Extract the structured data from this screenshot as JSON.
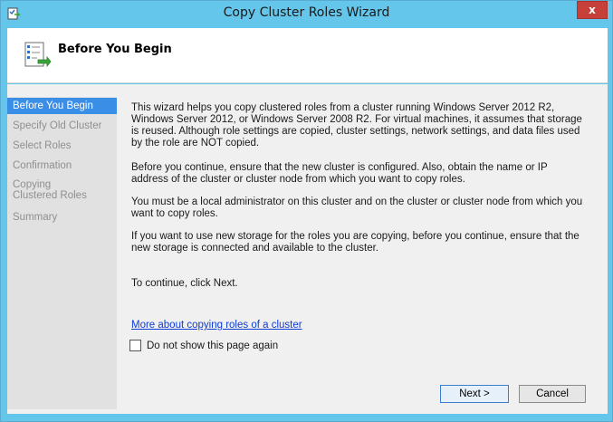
{
  "window": {
    "title": "Copy Cluster Roles Wizard",
    "close_label": "x"
  },
  "header": {
    "title": "Before You Begin"
  },
  "nav": {
    "items": [
      {
        "label": "Before You Begin",
        "active": true
      },
      {
        "label": "Specify Old Cluster",
        "active": false
      },
      {
        "label": "Select Roles",
        "active": false
      },
      {
        "label": "Confirmation",
        "active": false
      },
      {
        "label": "Copying Clustered Roles",
        "active": false
      },
      {
        "label": "Summary",
        "active": false
      }
    ]
  },
  "content": {
    "paragraphs": [
      "This wizard helps you copy clustered roles from a cluster running Windows Server 2012 R2, Windows Server 2012, or Windows Server 2008 R2. For virtual machines, it assumes that storage is reused. Although role settings are copied, cluster settings, network settings, and data files used by the role are NOT copied.",
      "Before you continue, ensure that the new cluster is configured. Also, obtain the name or IP address of the cluster or cluster node from which you want to copy roles.",
      "You must be a local administrator on this cluster and on the cluster or cluster node from which you want to copy roles.",
      "If you want to use new storage for the roles you are copying, before you continue, ensure that the new storage is connected and available to the cluster.",
      "To continue, click Next."
    ],
    "link": "More about copying roles of a cluster",
    "checkbox_label": "Do not show this page again"
  },
  "buttons": {
    "next": "Next >",
    "cancel": "Cancel"
  },
  "colors": {
    "titlebar": "#65c6ec",
    "active_nav": "#3a8ee6",
    "close": "#c7403a",
    "link": "#0e3cd4"
  },
  "icons": {
    "title": "wizard-app-icon",
    "header": "checklist-icon"
  }
}
